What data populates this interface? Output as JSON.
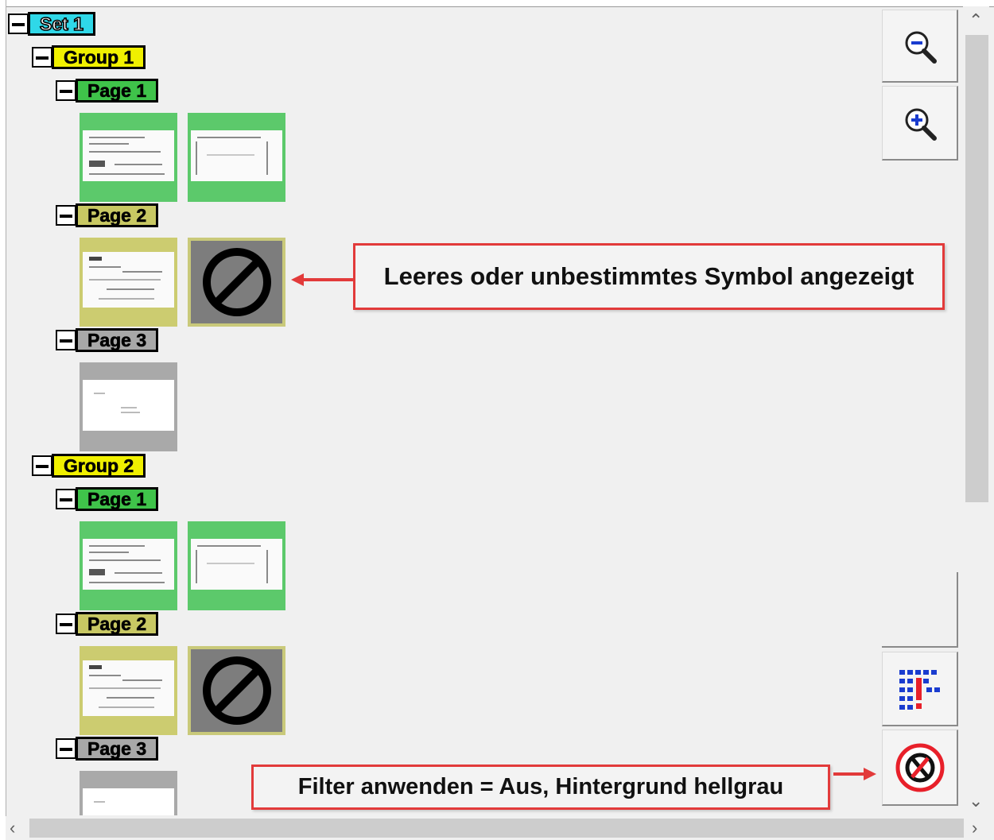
{
  "tree": {
    "set": {
      "label": "Set 1"
    },
    "group1": {
      "label": "Group 1",
      "page1": {
        "label": "Page 1"
      },
      "page2": {
        "label": "Page 2"
      },
      "page3": {
        "label": "Page 3"
      }
    },
    "group2": {
      "label": "Group 2",
      "page1": {
        "label": "Page 1"
      },
      "page2": {
        "label": "Page 2"
      },
      "page3": {
        "label": "Page 3"
      }
    }
  },
  "callouts": {
    "blank_symbol": "Leeres oder unbestimmtes Symbol angezeigt",
    "filter": "Filter anwenden = Aus, Hintergrund hellgrau"
  },
  "toolbar": {
    "zoom_out_icon": "zoom-out-icon",
    "zoom_in_icon": "zoom-in-icon",
    "filter_icon": "filter-icon",
    "no_filter_icon": "no-filter-icon"
  },
  "colors": {
    "set": "#2fd8e8",
    "group": "#f0f000",
    "page_green": "#3fc34a",
    "page_olive": "#c8c863",
    "page_gray": "#a8a8a8",
    "callout_border": "#e23a3a"
  }
}
